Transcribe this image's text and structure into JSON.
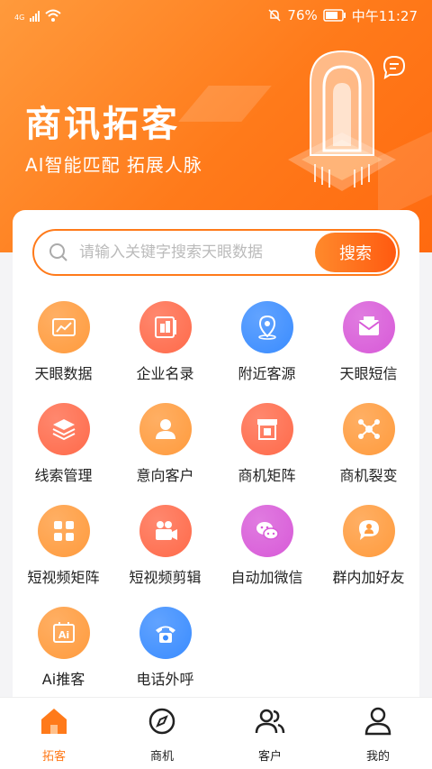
{
  "status_bar": {
    "network": "4G",
    "battery": "76%",
    "time": "中午11:27"
  },
  "header": {
    "title": "商讯拓客",
    "subtitle": "AI智能匹配 拓展人脉",
    "message_icon": "chat-bubble-icon"
  },
  "search": {
    "placeholder": "请输入关键字搜索天眼数据",
    "button_label": "搜索"
  },
  "features": [
    {
      "label": "天眼数据",
      "icon": "chart-board-icon",
      "color": "#ff9b3d"
    },
    {
      "label": "企业名录",
      "icon": "company-book-icon",
      "color": "#ff6a4a"
    },
    {
      "label": "附近客源",
      "icon": "location-pin-icon",
      "color": "#3a8cff"
    },
    {
      "label": "天眼短信",
      "icon": "envelope-icon",
      "color": "#d85ad8"
    },
    {
      "label": "线索管理",
      "icon": "layers-icon",
      "color": "#ff6a4a"
    },
    {
      "label": "意向客户",
      "icon": "user-icon",
      "color": "#ff9b3d"
    },
    {
      "label": "商机矩阵",
      "icon": "shop-icon",
      "color": "#ff6a4a"
    },
    {
      "label": "商机裂变",
      "icon": "network-nodes-icon",
      "color": "#ff9b3d"
    },
    {
      "label": "短视频矩阵",
      "icon": "video-grid-icon",
      "color": "#ff9b3d"
    },
    {
      "label": "短视频剪辑",
      "icon": "video-camera-icon",
      "color": "#ff6a4a"
    },
    {
      "label": "自动加微信",
      "icon": "wechat-icon",
      "color": "#d85ad8"
    },
    {
      "label": "群内加好友",
      "icon": "group-chat-icon",
      "color": "#ff9b3d"
    },
    {
      "label": "Ai推客",
      "icon": "ai-board-icon",
      "color": "#ff9b3d"
    },
    {
      "label": "电话外呼",
      "icon": "telephone-icon",
      "color": "#3a8cff"
    }
  ],
  "tabbar": {
    "items": [
      {
        "label": "拓客",
        "icon": "home-icon",
        "active": true
      },
      {
        "label": "商机",
        "icon": "compass-icon",
        "active": false
      },
      {
        "label": "客户",
        "icon": "users-icon",
        "active": false
      },
      {
        "label": "我的",
        "icon": "person-icon",
        "active": false
      }
    ]
  },
  "colors": {
    "accent": "#ff7a1a",
    "accent_dark": "#ff5a10"
  }
}
